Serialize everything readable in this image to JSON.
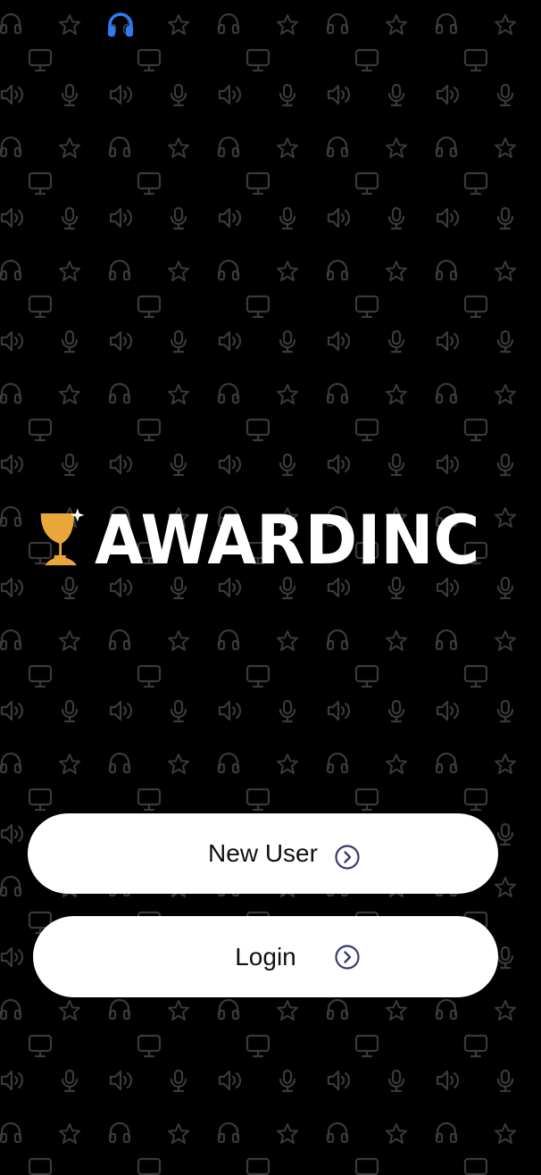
{
  "app": {
    "brand_name": "AWARDINC"
  },
  "colors": {
    "background": "#000000",
    "pattern_icon": "#3a3a3a",
    "trophy_gold": "#E9A73B",
    "status_icon_blue": "#2F7BF5",
    "button_bg": "#FFFFFF",
    "chevron": "#3B3A6E"
  },
  "status_bar": {
    "icon": "headphones-icon"
  },
  "background_pattern": {
    "icons": [
      "headphones-icon",
      "star-icon",
      "monitor-icon",
      "speaker-icon",
      "microphone-icon"
    ]
  },
  "actions": {
    "new_user": {
      "label": "New User",
      "icon": "chevron-right-circle-icon"
    },
    "login": {
      "label": "Login",
      "icon": "chevron-right-circle-icon"
    }
  }
}
